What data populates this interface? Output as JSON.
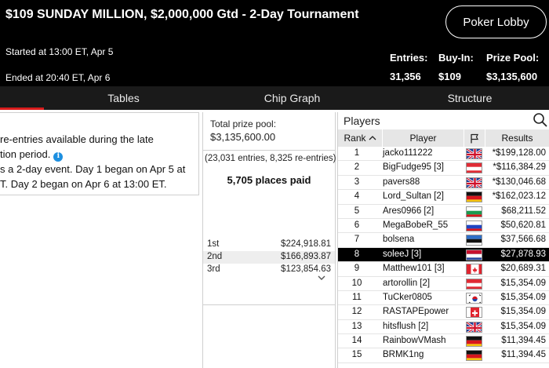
{
  "header": {
    "title": "$109 SUNDAY MILLION, $2,000,000 Gtd - 2-Day Tournament",
    "started": "Started at 13:00 ET, Apr 5",
    "ended": "Ended at 20:40 ET, Apr 6",
    "lobby_button": "Poker Lobby",
    "stats": [
      {
        "label": "Entries:",
        "value": "31,356"
      },
      {
        "label": "Buy-In:",
        "value": "$109"
      },
      {
        "label": "Prize Pool:",
        "value": "$3,135,600"
      }
    ]
  },
  "tabs": [
    "Tables",
    "Chip Graph",
    "Structure"
  ],
  "colors": {
    "accent": "#d91c1c",
    "header_bg": "#000000",
    "tabbar_bg": "#1a1a1a",
    "info_blue": "#1d8fe0"
  },
  "info": {
    "line1": "re-entries available during the late",
    "line2": "tion period.",
    "line3": "s a 2-day event. Day 1 began on Apr 5 at",
    "line4": "T. Day 2 began on Apr 6 at 13:00 ET.",
    "info_icon": "i"
  },
  "prize": {
    "label": "Total prize pool:",
    "value": "$3,135,600.00",
    "entries": "(23,031 entries, 8,325 re-entries)",
    "places_paid": "5,705 places paid",
    "payouts": [
      {
        "place": "1st",
        "amount": "$224,918.81"
      },
      {
        "place": "2nd",
        "amount": "$166,893.87"
      },
      {
        "place": "3rd",
        "amount": "$123,854.63"
      }
    ]
  },
  "players": {
    "title": "Players",
    "columns": {
      "rank": "Rank",
      "player": "Player",
      "results": "Results"
    },
    "rows": [
      {
        "rank": "1",
        "name": "jacko111222",
        "flag": "gb",
        "result": "*$199,128.00"
      },
      {
        "rank": "2",
        "name": "BigFudge95 [3]",
        "flag": "at",
        "result": "*$116,384.29"
      },
      {
        "rank": "3",
        "name": "pavers88",
        "flag": "gb",
        "result": "*$130,046.68"
      },
      {
        "rank": "4",
        "name": "Lord_Sultan [2]",
        "flag": "de",
        "result": "*$162,023.12"
      },
      {
        "rank": "5",
        "name": "Ares0966 [2]",
        "flag": "bg",
        "result": "$68,211.52"
      },
      {
        "rank": "6",
        "name": "MegaBobeR_55",
        "flag": "ru",
        "result": "$50,620.81"
      },
      {
        "rank": "7",
        "name": "bolsena",
        "flag": "ee",
        "result": "$37,566.68"
      },
      {
        "rank": "8",
        "name": "soleeJ [3]",
        "flag": "nl",
        "result": "$27,878.93",
        "selected": true
      },
      {
        "rank": "9",
        "name": "Matthew101 [3]",
        "flag": "ca",
        "result": "$20,689.31"
      },
      {
        "rank": "10",
        "name": "artorollin [2]",
        "flag": "at",
        "result": "$15,354.09"
      },
      {
        "rank": "11",
        "name": "TuCker0805",
        "flag": "kr",
        "result": "$15,354.09"
      },
      {
        "rank": "12",
        "name": "RASTAPEpower",
        "flag": "ch",
        "result": "$15,354.09"
      },
      {
        "rank": "13",
        "name": "hitsflush [2]",
        "flag": "gb",
        "result": "$15,354.09"
      },
      {
        "rank": "14",
        "name": "RainbowVMash",
        "flag": "de",
        "result": "$11,394.45"
      },
      {
        "rank": "15",
        "name": "BRMK1ng",
        "flag": "de",
        "result": "$11,394.45"
      }
    ]
  }
}
